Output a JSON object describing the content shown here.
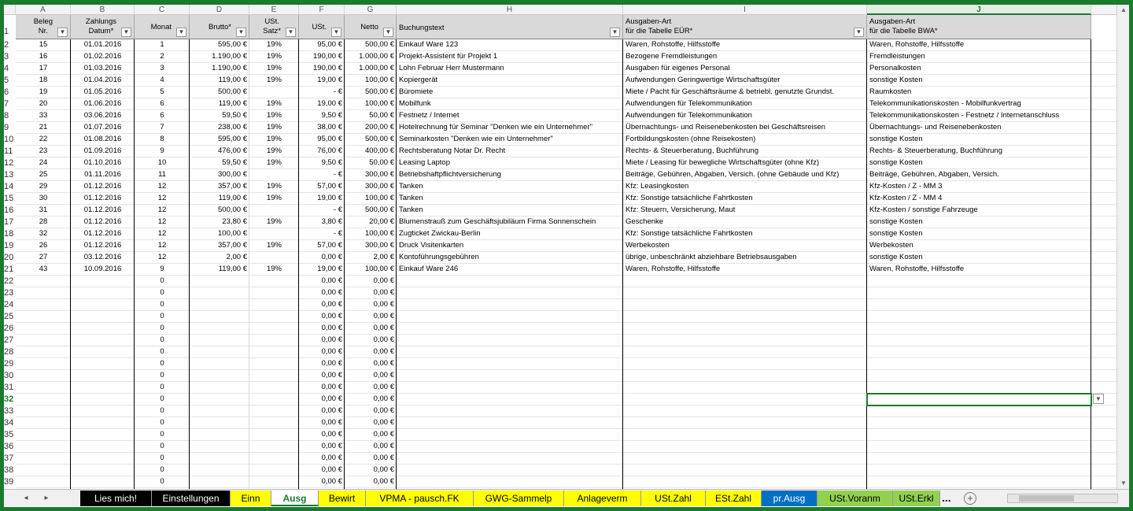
{
  "col_letters": [
    "A",
    "B",
    "C",
    "D",
    "E",
    "F",
    "G",
    "H",
    "I",
    "J"
  ],
  "active_col": "J",
  "header": {
    "a": [
      "Beleg",
      "Nr."
    ],
    "b": [
      "Zahlungs",
      "Datum*"
    ],
    "c": "Monat",
    "d": "Brutto*",
    "e": [
      "USt.",
      "Satz*"
    ],
    "f": "USt.",
    "g": "Netto",
    "h": "Buchungstext",
    "i": [
      "Ausgaben-Art",
      "für die Tabelle EÜR*"
    ],
    "j": [
      "Ausgaben-Art",
      "für die Tabelle BWA*"
    ]
  },
  "rows": [
    {
      "n": "2",
      "a": "15",
      "b": "01.01.2016",
      "c": "1",
      "d": "595,00 €",
      "e": "19%",
      "f": "95,00 €",
      "g": "500,00 €",
      "h": "Einkauf Ware 123",
      "i": "Waren, Rohstoffe, Hilfsstoffe",
      "j": "Waren, Rohstoffe, Hilfsstoffe"
    },
    {
      "n": "3",
      "a": "16",
      "b": "01.02.2016",
      "c": "2",
      "d": "1.190,00 €",
      "e": "19%",
      "f": "190,00 €",
      "g": "1.000,00 €",
      "h": "Projekt-Assistent für Projekt 1",
      "i": "Bezogene Fremdleistungen",
      "j": "Fremdleistungen"
    },
    {
      "n": "4",
      "a": "17",
      "b": "01.03.2016",
      "c": "3",
      "d": "1.190,00 €",
      "e": "19%",
      "f": "190,00 €",
      "g": "1.000,00 €",
      "h": "Lohn Februar Herr Mustermann",
      "i": "Ausgaben für eigenes Personal",
      "j": "Personalkosten"
    },
    {
      "n": "5",
      "a": "18",
      "b": "01.04.2016",
      "c": "4",
      "d": "119,00 €",
      "e": "19%",
      "f": "19,00 €",
      "g": "100,00 €",
      "h": "Kopiergerät",
      "i": "Aufwendungen Geringwertige Wirtschaftsgüter",
      "j": "sonstige Kosten"
    },
    {
      "n": "6",
      "a": "19",
      "b": "01.05.2016",
      "c": "5",
      "d": "500,00 €",
      "e": "",
      "f": "-   €",
      "g": "500,00 €",
      "h": "Büromiete",
      "i": "Miete / Pacht für Geschäftsräume & betriebl. genutzte Grundst.",
      "j": "Raumkosten"
    },
    {
      "n": "7",
      "a": "20",
      "b": "01.06.2016",
      "c": "6",
      "d": "119,00 €",
      "e": "19%",
      "f": "19,00 €",
      "g": "100,00 €",
      "h": "Mobilfunk",
      "i": "Aufwendungen für Telekommunikation",
      "j": "Telekommunikationskosten - Mobilfunkvertrag"
    },
    {
      "n": "8",
      "a": "33",
      "b": "03.06.2016",
      "c": "6",
      "d": "59,50 €",
      "e": "19%",
      "f": "9,50 €",
      "g": "50,00 €",
      "h": "Festnetz / Internet",
      "i": "Aufwendungen für Telekommunikation",
      "j": "Telekommunikationskosten - Festnetz / Internetanschluss"
    },
    {
      "n": "9",
      "a": "21",
      "b": "01.07.2016",
      "c": "7",
      "d": "238,00 €",
      "e": "19%",
      "f": "38,00 €",
      "g": "200,00 €",
      "h": "Hotelrechnung für Seminar \"Denken wie ein Unternehmer\"",
      "i": "Übernachtungs- und Reisenebenkosten bei Geschäftsreisen",
      "j": "Übernachtungs- und Reisenebenkosten"
    },
    {
      "n": "10",
      "a": "22",
      "b": "01.08.2016",
      "c": "8",
      "d": "595,00 €",
      "e": "19%",
      "f": "95,00 €",
      "g": "500,00 €",
      "h": "Seminarkosten \"Denken wie ein Unternehmer\"",
      "i": "Fortbildungskosten (ohne Reisekosten)",
      "j": "sonstige Kosten"
    },
    {
      "n": "11",
      "a": "23",
      "b": "01.09.2016",
      "c": "9",
      "d": "476,00 €",
      "e": "19%",
      "f": "76,00 €",
      "g": "400,00 €",
      "h": "Rechtsberatung Notar Dr. Recht",
      "i": "Rechts- & Steuerberatung, Buchführung",
      "j": "Rechts- & Steuerberatung, Buchführung"
    },
    {
      "n": "12",
      "a": "24",
      "b": "01.10.2016",
      "c": "10",
      "d": "59,50 €",
      "e": "19%",
      "f": "9,50 €",
      "g": "50,00 €",
      "h": "Leasing Laptop",
      "i": "Miete / Leasing für bewegliche Wirtschaftsgüter (ohne Kfz)",
      "j": "sonstige Kosten"
    },
    {
      "n": "13",
      "a": "25",
      "b": "01.11.2016",
      "c": "11",
      "d": "300,00 €",
      "e": "",
      "f": "-   €",
      "g": "300,00 €",
      "h": "Betriebshaftpflichtversicherung",
      "i": "Beiträge, Gebühren, Abgaben, Versich. (ohne Gebäude und Kfz)",
      "j": "Beiträge, Gebühren, Abgaben, Versich."
    },
    {
      "n": "14",
      "a": "29",
      "b": "01.12.2016",
      "c": "12",
      "d": "357,00 €",
      "e": "19%",
      "f": "57,00 €",
      "g": "300,00 €",
      "h": "Tanken",
      "i": "Kfz: Leasingkosten",
      "j": "Kfz-Kosten / Z - MM 3"
    },
    {
      "n": "15",
      "a": "30",
      "b": "01.12.2016",
      "c": "12",
      "d": "119,00 €",
      "e": "19%",
      "f": "19,00 €",
      "g": "100,00 €",
      "h": "Tanken",
      "i": "Kfz: Sonstige tatsächliche Fahrtkosten",
      "j": "Kfz-Kosten / Z - MM 4"
    },
    {
      "n": "16",
      "a": "31",
      "b": "01.12.2016",
      "c": "12",
      "d": "500,00 €",
      "e": "",
      "f": "-   €",
      "g": "500,00 €",
      "h": "Tanken",
      "i": "Kfz: Steuern, Versicherung, Maut",
      "j": "Kfz-Kosten / sonstige Fahrzeuge"
    },
    {
      "n": "17",
      "a": "28",
      "b": "01.12.2016",
      "c": "12",
      "d": "23,80 €",
      "e": "19%",
      "f": "3,80 €",
      "g": "20,00 €",
      "h": "Blumenstrauß zum Geschäftsjubiläum Firma Sonnenschein",
      "i": "Geschenke",
      "j": "sonstige Kosten"
    },
    {
      "n": "18",
      "a": "32",
      "b": "01.12.2016",
      "c": "12",
      "d": "100,00 €",
      "e": "",
      "f": "-   €",
      "g": "100,00 €",
      "h": "Zugticket Zwickau-Berlin",
      "i": "Kfz: Sonstige tatsächliche Fahrtkosten",
      "j": "sonstige Kosten"
    },
    {
      "n": "19",
      "a": "26",
      "b": "01.12.2016",
      "c": "12",
      "d": "357,00 €",
      "e": "19%",
      "f": "57,00 €",
      "g": "300,00 €",
      "h": "Druck Visitenkarten",
      "i": "Werbekosten",
      "j": "Werbekosten"
    },
    {
      "n": "20",
      "a": "27",
      "b": "03.12.2016",
      "c": "12",
      "d": "2,00 €",
      "e": "",
      "f": "0,00 €",
      "g": "2,00 €",
      "h": "Kontoführungsgebühren",
      "i": "übrige, unbeschränkt abziehbare Betriebsausgaben",
      "j": "sonstige Kosten"
    },
    {
      "n": "21",
      "a": "43",
      "b": "10.09.2016",
      "c": "9",
      "d": "119,00 €",
      "e": "19%",
      "f": "19,00 €",
      "g": "100,00 €",
      "h": "Einkauf Ware 246",
      "i": "Waren, Rohstoffe, Hilfsstoffe",
      "j": "Waren, Rohstoffe, Hilfsstoffe"
    },
    {
      "n": "22",
      "a": "",
      "b": "",
      "c": "0",
      "d": "",
      "e": "",
      "f": "0,00 €",
      "g": "0,00 €",
      "h": "",
      "i": "",
      "j": ""
    },
    {
      "n": "23",
      "a": "",
      "b": "",
      "c": "0",
      "d": "",
      "e": "",
      "f": "0,00 €",
      "g": "0,00 €",
      "h": "",
      "i": "",
      "j": ""
    },
    {
      "n": "24",
      "a": "",
      "b": "",
      "c": "0",
      "d": "",
      "e": "",
      "f": "0,00 €",
      "g": "0,00 €",
      "h": "",
      "i": "",
      "j": ""
    },
    {
      "n": "25",
      "a": "",
      "b": "",
      "c": "0",
      "d": "",
      "e": "",
      "f": "0,00 €",
      "g": "0,00 €",
      "h": "",
      "i": "",
      "j": ""
    },
    {
      "n": "26",
      "a": "",
      "b": "",
      "c": "0",
      "d": "",
      "e": "",
      "f": "0,00 €",
      "g": "0,00 €",
      "h": "",
      "i": "",
      "j": ""
    },
    {
      "n": "27",
      "a": "",
      "b": "",
      "c": "0",
      "d": "",
      "e": "",
      "f": "0,00 €",
      "g": "0,00 €",
      "h": "",
      "i": "",
      "j": ""
    },
    {
      "n": "28",
      "a": "",
      "b": "",
      "c": "0",
      "d": "",
      "e": "",
      "f": "0,00 €",
      "g": "0,00 €",
      "h": "",
      "i": "",
      "j": ""
    },
    {
      "n": "29",
      "a": "",
      "b": "",
      "c": "0",
      "d": "",
      "e": "",
      "f": "0,00 €",
      "g": "0,00 €",
      "h": "",
      "i": "",
      "j": ""
    },
    {
      "n": "30",
      "a": "",
      "b": "",
      "c": "0",
      "d": "",
      "e": "",
      "f": "0,00 €",
      "g": "0,00 €",
      "h": "",
      "i": "",
      "j": ""
    },
    {
      "n": "31",
      "a": "",
      "b": "",
      "c": "0",
      "d": "",
      "e": "",
      "f": "0,00 €",
      "g": "0,00 €",
      "h": "",
      "i": "",
      "j": ""
    },
    {
      "n": "32",
      "a": "",
      "b": "",
      "c": "0",
      "d": "",
      "e": "",
      "f": "0,00 €",
      "g": "0,00 €",
      "h": "",
      "i": "",
      "j": ""
    },
    {
      "n": "33",
      "a": "",
      "b": "",
      "c": "0",
      "d": "",
      "e": "",
      "f": "0,00 €",
      "g": "0,00 €",
      "h": "",
      "i": "",
      "j": ""
    },
    {
      "n": "34",
      "a": "",
      "b": "",
      "c": "0",
      "d": "",
      "e": "",
      "f": "0,00 €",
      "g": "0,00 €",
      "h": "",
      "i": "",
      "j": ""
    },
    {
      "n": "35",
      "a": "",
      "b": "",
      "c": "0",
      "d": "",
      "e": "",
      "f": "0,00 €",
      "g": "0,00 €",
      "h": "",
      "i": "",
      "j": ""
    },
    {
      "n": "36",
      "a": "",
      "b": "",
      "c": "0",
      "d": "",
      "e": "",
      "f": "0,00 €",
      "g": "0,00 €",
      "h": "",
      "i": "",
      "j": ""
    },
    {
      "n": "37",
      "a": "",
      "b": "",
      "c": "0",
      "d": "",
      "e": "",
      "f": "0,00 €",
      "g": "0,00 €",
      "h": "",
      "i": "",
      "j": ""
    },
    {
      "n": "38",
      "a": "",
      "b": "",
      "c": "0",
      "d": "",
      "e": "",
      "f": "0,00 €",
      "g": "0,00 €",
      "h": "",
      "i": "",
      "j": ""
    },
    {
      "n": "39",
      "a": "",
      "b": "",
      "c": "0",
      "d": "",
      "e": "",
      "f": "0,00 €",
      "g": "0,00 €",
      "h": "",
      "i": "",
      "j": ""
    }
  ],
  "active_row": "32",
  "tabs": [
    {
      "label": "Lies mich!",
      "bg": "#000000",
      "fg": "#ffffff"
    },
    {
      "label": "Einstellungen",
      "bg": "#000000",
      "fg": "#ffffff"
    },
    {
      "label": "Einn",
      "bg": "#ffff00",
      "fg": "#000000"
    },
    {
      "label": "Ausg",
      "bg": "#ffffff",
      "fg": "#1b7a2e",
      "active": true
    },
    {
      "label": "Bewirt",
      "bg": "#ffff00",
      "fg": "#000000"
    },
    {
      "label": "VPMA - pausch.FK",
      "bg": "#ffff00",
      "fg": "#000000"
    },
    {
      "label": "GWG-Sammelp",
      "bg": "#ffff00",
      "fg": "#000000"
    },
    {
      "label": "Anlageverm",
      "bg": "#ffff00",
      "fg": "#000000"
    },
    {
      "label": "USt.Zahl",
      "bg": "#ffff00",
      "fg": "#000000"
    },
    {
      "label": "ESt.Zahl",
      "bg": "#ffff00",
      "fg": "#000000"
    },
    {
      "label": "pr.Ausg",
      "bg": "#0070c0",
      "fg": "#ffffff"
    },
    {
      "label": "USt.Voranm",
      "bg": "#92d050",
      "fg": "#000000"
    },
    {
      "label": "USt.Erkl",
      "bg": "#92d050",
      "fg": "#000000"
    }
  ],
  "tabs_more": "...",
  "add_sheet": "+",
  "icons": {
    "nav_next": "next-sheet-icon",
    "add": "add-sheet-icon",
    "filter": "filter-dropdown-icon"
  },
  "colors": {
    "accent": "#1b7a2e",
    "header_bg": "#d9d9d9"
  }
}
